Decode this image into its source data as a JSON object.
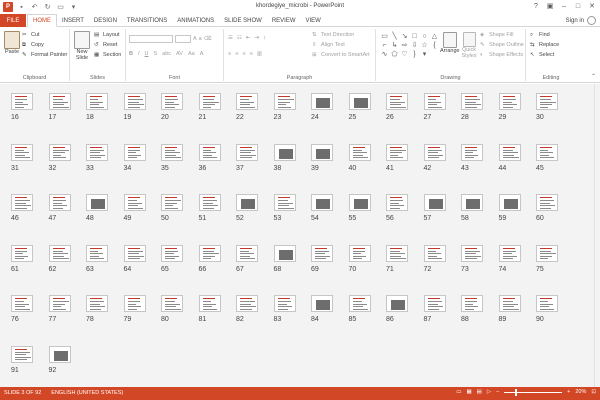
{
  "window": {
    "title": "khordegiye_microbi - PowerPoint",
    "file_tab": "FILE",
    "tabs": [
      "HOME",
      "INSERT",
      "DESIGN",
      "TRANSITIONS",
      "ANIMATIONS",
      "SLIDE SHOW",
      "REVIEW",
      "VIEW"
    ],
    "active_tab": "HOME",
    "sign_in": "Sign in"
  },
  "ribbon": {
    "clipboard": {
      "label": "Clipboard",
      "paste": "Paste",
      "cut": "Cut",
      "copy": "Copy",
      "format_painter": "Format Painter"
    },
    "slides": {
      "label": "Slides",
      "new_slide": "New Slide",
      "layout": "Layout",
      "reset": "Reset",
      "section": "Section"
    },
    "font": {
      "label": "Font"
    },
    "paragraph": {
      "label": "Paragraph",
      "text_direction": "Text Direction",
      "align_text": "Align Text",
      "convert_smartart": "Convert to SmartArt"
    },
    "drawing": {
      "label": "Drawing",
      "arrange": "Arrange",
      "quick_styles": "Quick Styles",
      "shape_fill": "Shape Fill",
      "shape_outline": "Shape Outline",
      "shape_effects": "Shape Effects"
    },
    "editing": {
      "label": "Editing",
      "find": "Find",
      "replace": "Replace",
      "select": "Select"
    }
  },
  "slides": {
    "first": 16,
    "last": 92,
    "per_row": 15,
    "image_slides": [
      24,
      25,
      38,
      39,
      48,
      52,
      54,
      55,
      57,
      58,
      59,
      68,
      84,
      86,
      92
    ]
  },
  "status": {
    "slide_info": "SLIDE 3 OF 92",
    "language": "ENGLISH (UNITED STATES)",
    "zoom": "20%",
    "zoom_fraction": 0.2
  },
  "colors": {
    "accent": "#d24726"
  }
}
